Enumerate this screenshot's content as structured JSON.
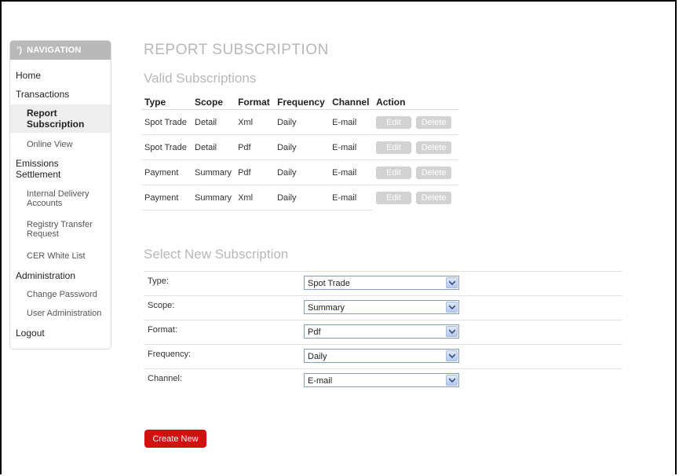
{
  "sidebar": {
    "header": "NAVIGATION",
    "items": {
      "home": "Home",
      "transactions": "Transactions",
      "report_subscription": "Report Subscription",
      "online_view": "Online View",
      "emissions_settlement": "Emissions Settlement",
      "internal_delivery_accounts": "Internal Delivery Accounts",
      "registry_transfer_request": "Registry Transfer Request",
      "cer_white_list": "CER White List",
      "administration": "Administration",
      "change_password": "Change Password",
      "user_administration": "User Administration",
      "logout": "Logout"
    }
  },
  "main": {
    "title": "REPORT SUBSCRIPTION",
    "valid_title": "Valid Subscriptions",
    "columns": [
      "Type",
      "Scope",
      "Format",
      "Frequency",
      "Channel",
      "Action"
    ],
    "rows": [
      [
        "Spot Trade",
        "Detail",
        "Xml",
        "Daily",
        "E-mail"
      ],
      [
        "Spot Trade",
        "Detail",
        "Pdf",
        "Daily",
        "E-mail"
      ],
      [
        "Payment",
        "Summary",
        "Pdf",
        "Daily",
        "E-mail"
      ],
      [
        "Payment",
        "Summary",
        "Xml",
        "Daily",
        "E-mail"
      ]
    ],
    "edit_label": "Edit",
    "delete_label": "Delete",
    "new_title": "Select New Subscription",
    "form": [
      {
        "label": "Type:",
        "value": "Spot Trade"
      },
      {
        "label": "Scope:",
        "value": "Summary"
      },
      {
        "label": "Format:",
        "value": "Pdf"
      },
      {
        "label": "Frequency:",
        "value": "Daily"
      },
      {
        "label": "Channel:",
        "value": "E-mail"
      }
    ],
    "create_label": "Create New"
  },
  "colors": {
    "accent_red": "#d21010",
    "muted_button": "#d2d2d2",
    "title_grey": "#b8b8b8"
  }
}
